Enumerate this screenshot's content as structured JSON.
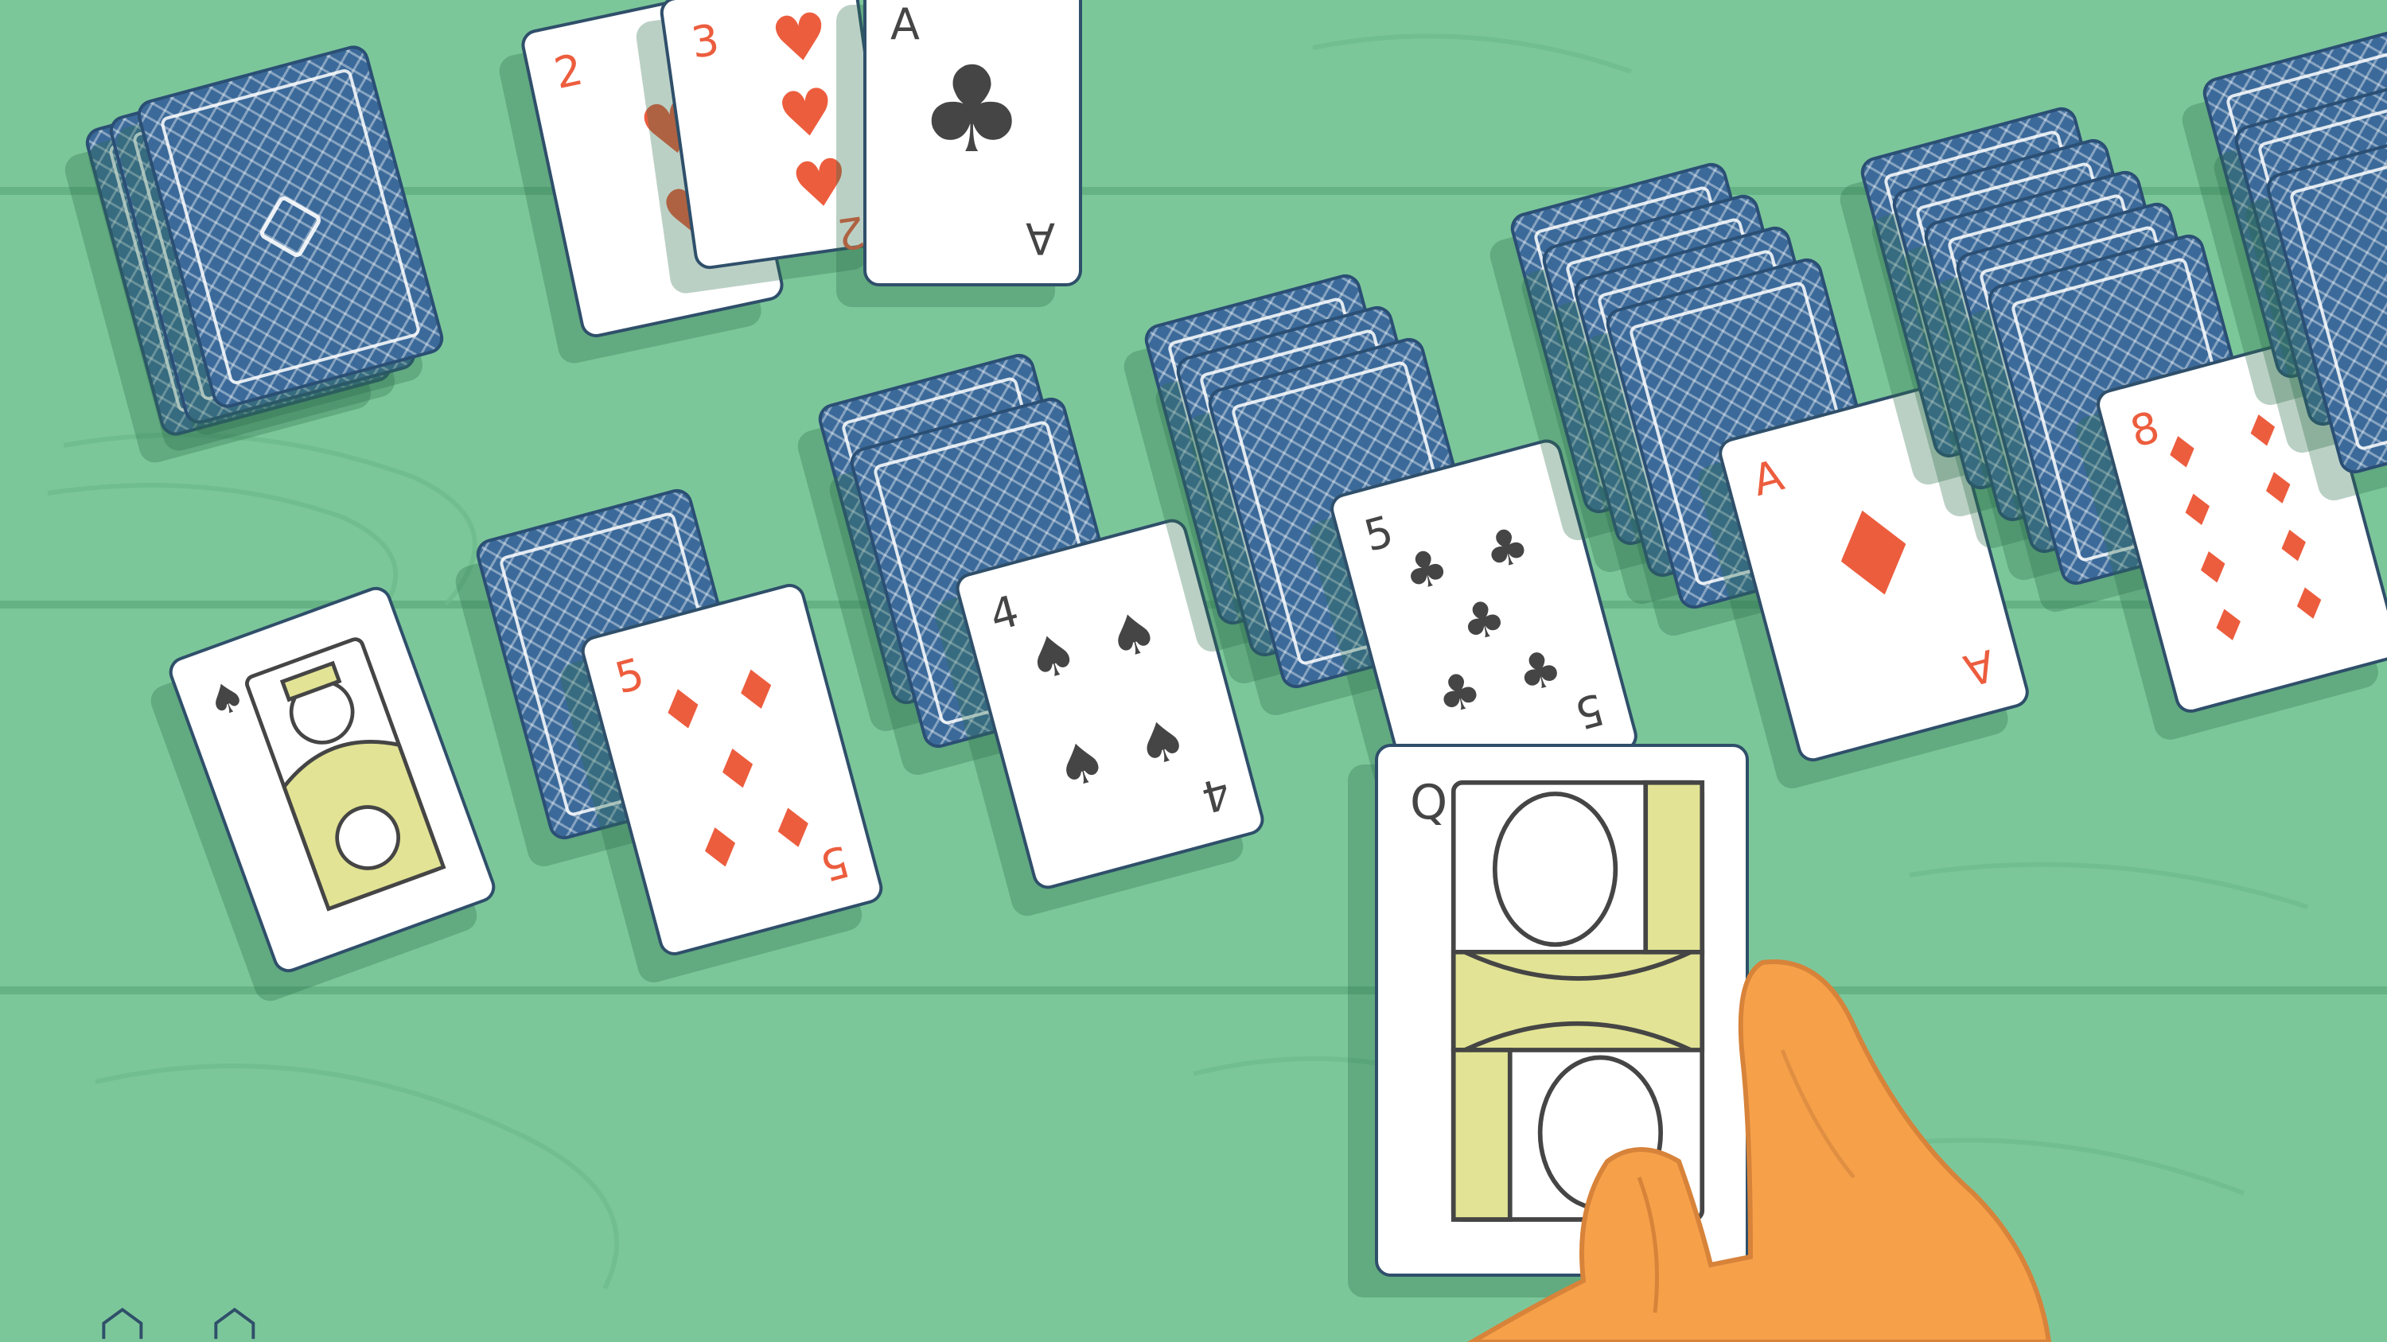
{
  "colors": {
    "felt": "#7cc79a",
    "felt_line": "#5fae7f",
    "card_back": "#3b6a9a",
    "card_outline": "#2f4f6a",
    "red_suit": "#ec5d3e",
    "black_suit": "#454545",
    "court_yellow": "#e2e394",
    "hand": "#f6a14a"
  },
  "stock": {
    "icon": "card-back-pattern-icon"
  },
  "foundation": [
    {
      "rank": "2",
      "suit": "hearts",
      "suit_symbol": "♥",
      "color": "red"
    },
    {
      "rank": "3",
      "suit": "hearts",
      "suit_symbol": "♥",
      "color": "red",
      "corner_rank": "2"
    },
    {
      "rank": "A",
      "suit": "clubs",
      "suit_symbol": "♣",
      "color": "black"
    }
  ],
  "tableau": [
    {
      "rank": "",
      "suit": "spades",
      "suit_symbol": "♠",
      "court": "king",
      "color": "black"
    },
    {
      "rank": "5",
      "suit": "diamonds",
      "suit_symbol": "♦",
      "color": "red"
    },
    {
      "rank": "4",
      "suit": "spades",
      "suit_symbol": "♠",
      "color": "black"
    },
    {
      "rank": "5",
      "suit": "clubs",
      "suit_symbol": "♣",
      "color": "black"
    },
    {
      "rank": "A",
      "suit": "diamonds",
      "suit_symbol": "♦",
      "color": "red"
    },
    {
      "rank": "8",
      "suit": "diamonds",
      "suit_symbol": "♦",
      "color": "red"
    }
  ],
  "held_card": {
    "rank": "Q",
    "suit": "",
    "court": "queen",
    "icon": "queen-portrait-icon"
  },
  "hand_icon": "hand-icon",
  "brand_icon": "house-logo-icon"
}
